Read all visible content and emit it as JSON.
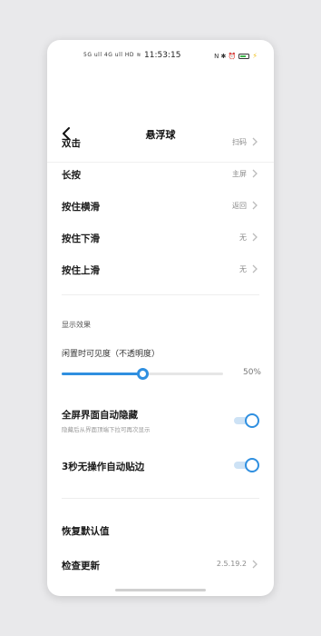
{
  "status_bar": {
    "left_icons": "5G ull 4G ull HD ≋ ",
    "time": "11:53:15",
    "right_icons": "N ✱ ⏰"
  },
  "header": {
    "title": "悬浮球"
  },
  "gestures": [
    {
      "label": "双击",
      "value": "扫码"
    },
    {
      "label": "长按",
      "value": "主屏"
    },
    {
      "label": "按住横滑",
      "value": "返回"
    },
    {
      "label": "按住下滑",
      "value": "无"
    },
    {
      "label": "按住上滑",
      "value": "无"
    }
  ],
  "display": {
    "section_title": "显示效果",
    "slider_label": "闲置时可见度（不透明度）",
    "slider_percent": 50,
    "slider_value_text": "50%"
  },
  "toggles": [
    {
      "label": "全屏界面自动隐藏",
      "sub": "隐藏后从界面顶端下拉可再次显示",
      "on": true
    },
    {
      "label": "3秒无操作自动贴边",
      "sub": "",
      "on": true
    }
  ],
  "footer": {
    "reset_label": "恢复默认值",
    "update_label": "检查更新",
    "version": "2.5.19.2"
  },
  "colors": {
    "accent": "#2f8fe0",
    "background": "#ffffff"
  }
}
